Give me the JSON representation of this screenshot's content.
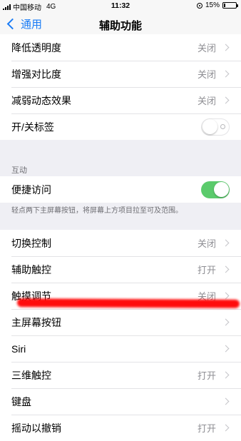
{
  "status": {
    "carrier": "中国移动",
    "network": "4G",
    "time": "11:32",
    "battery": "15%",
    "battery_level": 0.15
  },
  "nav": {
    "back_label": "通用",
    "title": "辅助功能"
  },
  "group1": [
    {
      "label": "降低透明度",
      "value": "关闭"
    },
    {
      "label": "增强对比度",
      "value": "关闭"
    },
    {
      "label": "减弱动态效果",
      "value": "关闭"
    },
    {
      "label": "开/关标签",
      "toggle": false
    }
  ],
  "interaction": {
    "header": "互动",
    "reachability_label": "便捷访问",
    "reachability_on": true,
    "note": "轻点两下主屏幕按钮，将屏幕上方项目拉至可及范围。"
  },
  "group3": [
    {
      "label": "切换控制",
      "value": "关闭"
    },
    {
      "label": "辅助触控",
      "value": "打开"
    },
    {
      "label": "触摸调节",
      "value": "关闭"
    },
    {
      "label": "主屏幕按钮",
      "value": ""
    },
    {
      "label": "Siri",
      "value": ""
    },
    {
      "label": "三维触控",
      "value": "打开"
    },
    {
      "label": "键盘",
      "value": ""
    },
    {
      "label": "摇动以撤销",
      "value": "打开"
    }
  ],
  "colors": {
    "accent": "#1a7cf5",
    "switch_on": "#5bcb6c",
    "annotation": "#ff0000"
  }
}
